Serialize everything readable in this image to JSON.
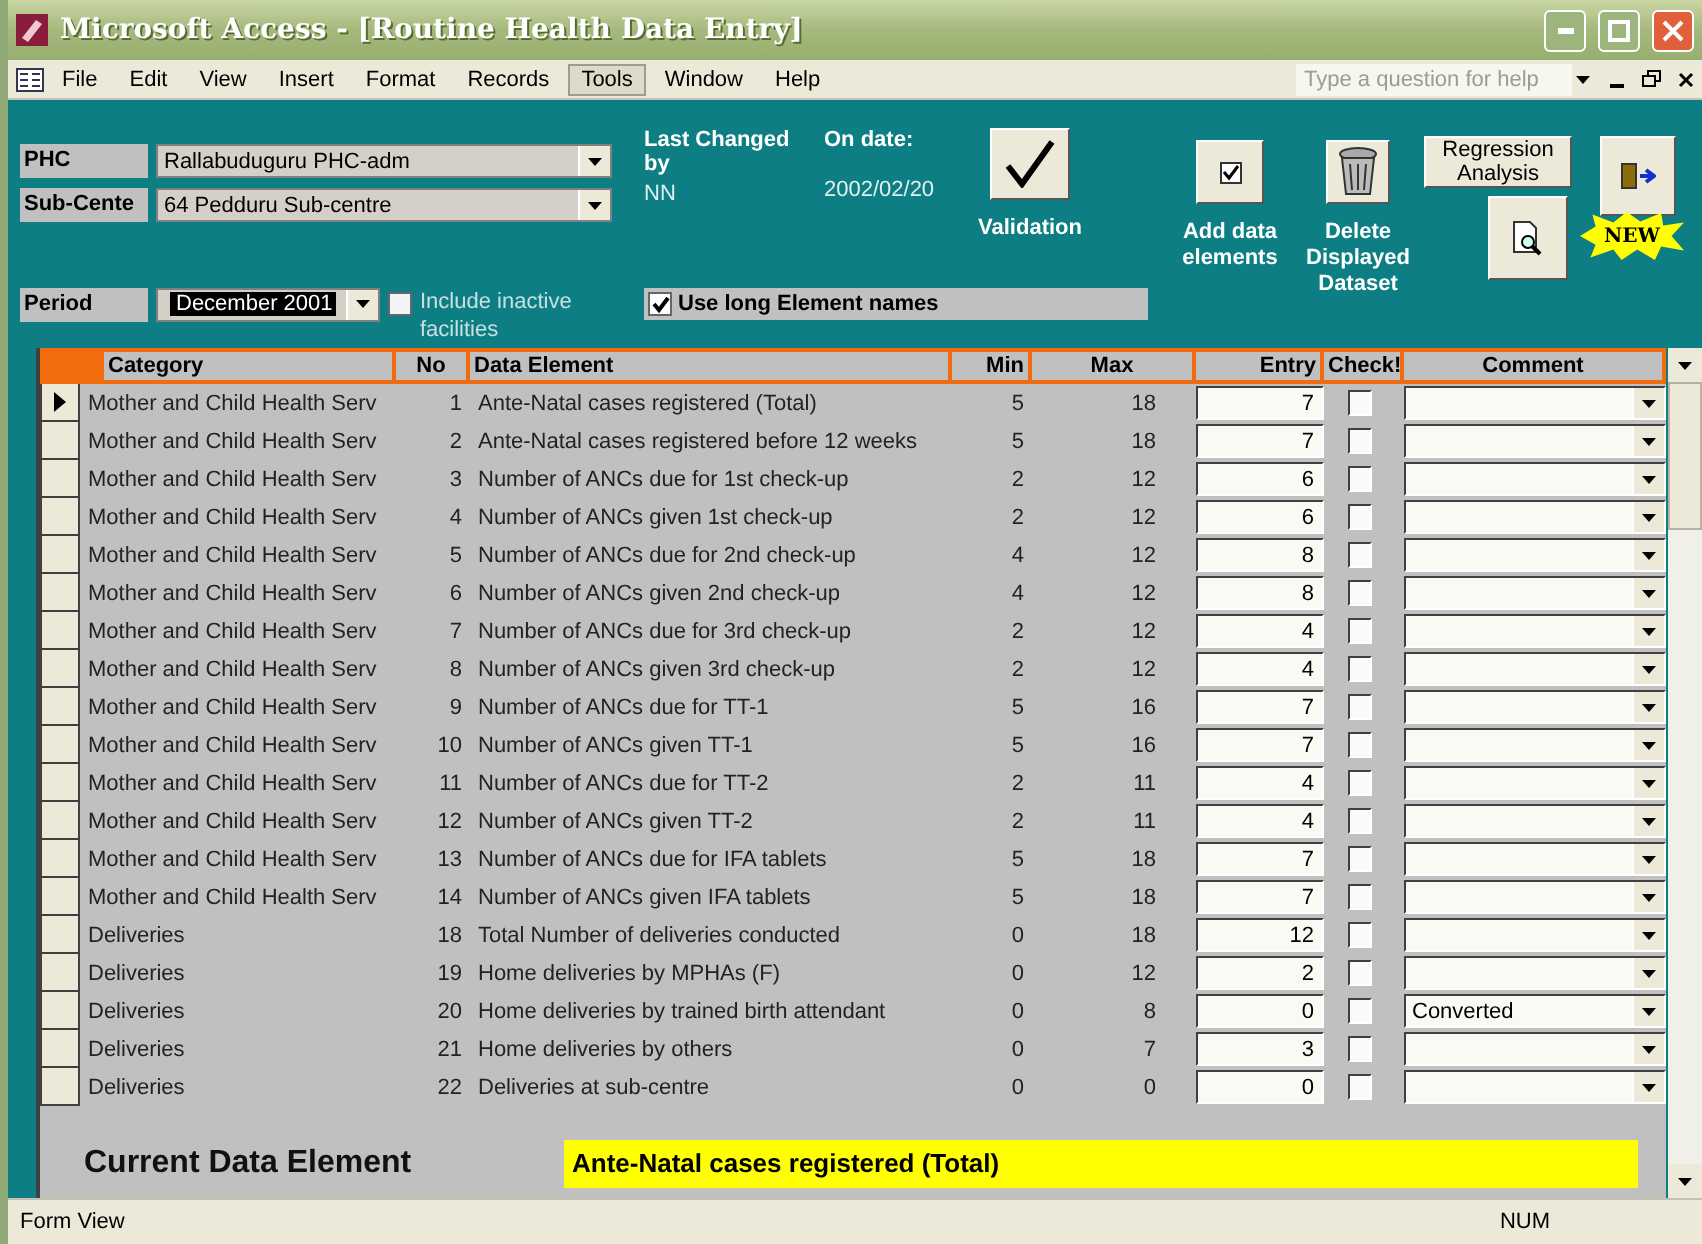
{
  "window": {
    "title": "Microsoft Access - [Routine Health Data Entry]"
  },
  "menu": [
    {
      "label": "File",
      "selected": false
    },
    {
      "label": "Edit",
      "selected": false
    },
    {
      "label": "View",
      "selected": false
    },
    {
      "label": "Insert",
      "selected": false
    },
    {
      "label": "Format",
      "selected": false
    },
    {
      "label": "Records",
      "selected": false
    },
    {
      "label": "Tools",
      "selected": true
    },
    {
      "label": "Window",
      "selected": false
    },
    {
      "label": "Help",
      "selected": false
    }
  ],
  "help_box": {
    "placeholder": "Type a question for help"
  },
  "filters": [
    {
      "label": "PHC",
      "value": "Rallabuduguru PHC-adm"
    },
    {
      "label": "Sub-Cente",
      "value": "64 Pedduru Sub-centre"
    }
  ],
  "period": {
    "label": "Period",
    "value": "December 2001",
    "include_inactive": {
      "label": "Include inactive facilities",
      "checked": false
    }
  },
  "last_changed": {
    "label": "Last Changed by",
    "value": "NN"
  },
  "on_date": {
    "label": "On date:",
    "value": "2002/02/20"
  },
  "use_long_names": {
    "label": "Use long Element names",
    "checked": true
  },
  "actions": {
    "validation": "Validation",
    "add_data": "Add data elements",
    "delete": "Delete Displayed Dataset",
    "regression": "Regression Analysis",
    "new_badge": "NEW"
  },
  "table": {
    "columns": [
      "Category",
      "No",
      "Data Element",
      "Min",
      "Max",
      "Entry",
      "Check!",
      "Comment"
    ],
    "rows": [
      {
        "current": true,
        "category": "Mother and Child Health Serv",
        "no": "1",
        "element": "Ante-Natal cases registered (Total)",
        "min": "5",
        "max": "18",
        "entry": "7",
        "checked": false,
        "comment": ""
      },
      {
        "current": false,
        "category": "Mother and Child Health Serv",
        "no": "2",
        "element": "Ante-Natal cases registered before 12 weeks",
        "min": "5",
        "max": "18",
        "entry": "7",
        "checked": false,
        "comment": ""
      },
      {
        "current": false,
        "category": "Mother and Child Health Serv",
        "no": "3",
        "element": "Number of ANCs due for 1st check-up",
        "min": "2",
        "max": "12",
        "entry": "6",
        "checked": false,
        "comment": ""
      },
      {
        "current": false,
        "category": "Mother and Child Health Serv",
        "no": "4",
        "element": "Number of ANCs given 1st check-up",
        "min": "2",
        "max": "12",
        "entry": "6",
        "checked": false,
        "comment": ""
      },
      {
        "current": false,
        "category": "Mother and Child Health Serv",
        "no": "5",
        "element": "Number of ANCs due for 2nd check-up",
        "min": "4",
        "max": "12",
        "entry": "8",
        "checked": false,
        "comment": ""
      },
      {
        "current": false,
        "category": "Mother and Child Health Serv",
        "no": "6",
        "element": "Number of ANCs given 2nd check-up",
        "min": "4",
        "max": "12",
        "entry": "8",
        "checked": false,
        "comment": ""
      },
      {
        "current": false,
        "category": "Mother and Child Health Serv",
        "no": "7",
        "element": "Number of ANCs due for 3rd check-up",
        "min": "2",
        "max": "12",
        "entry": "4",
        "checked": false,
        "comment": ""
      },
      {
        "current": false,
        "category": "Mother and Child Health Serv",
        "no": "8",
        "element": "Number of ANCs given 3rd check-up",
        "min": "2",
        "max": "12",
        "entry": "4",
        "checked": false,
        "comment": ""
      },
      {
        "current": false,
        "category": "Mother and Child Health Serv",
        "no": "9",
        "element": "Number of ANCs due for TT-1",
        "min": "5",
        "max": "16",
        "entry": "7",
        "checked": false,
        "comment": ""
      },
      {
        "current": false,
        "category": "Mother and Child Health Serv",
        "no": "10",
        "element": "Number of ANCs given TT-1",
        "min": "5",
        "max": "16",
        "entry": "7",
        "checked": false,
        "comment": ""
      },
      {
        "current": false,
        "category": "Mother and Child Health Serv",
        "no": "11",
        "element": "Number of ANCs due for TT-2",
        "min": "2",
        "max": "11",
        "entry": "4",
        "checked": false,
        "comment": ""
      },
      {
        "current": false,
        "category": "Mother and Child Health Serv",
        "no": "12",
        "element": "Number of ANCs given TT-2",
        "min": "2",
        "max": "11",
        "entry": "4",
        "checked": false,
        "comment": ""
      },
      {
        "current": false,
        "category": "Mother and Child Health Serv",
        "no": "13",
        "element": "Number of ANCs due for IFA tablets",
        "min": "5",
        "max": "18",
        "entry": "7",
        "checked": false,
        "comment": ""
      },
      {
        "current": false,
        "category": "Mother and Child Health Serv",
        "no": "14",
        "element": "Number of ANCs given IFA tablets",
        "min": "5",
        "max": "18",
        "entry": "7",
        "checked": false,
        "comment": ""
      },
      {
        "current": false,
        "category": "Deliveries",
        "no": "18",
        "element": "Total Number of deliveries conducted",
        "min": "0",
        "max": "18",
        "entry": "12",
        "checked": false,
        "comment": ""
      },
      {
        "current": false,
        "category": "Deliveries",
        "no": "19",
        "element": "Home deliveries by MPHAs (F)",
        "min": "0",
        "max": "12",
        "entry": "2",
        "checked": false,
        "comment": ""
      },
      {
        "current": false,
        "category": "Deliveries",
        "no": "20",
        "element": "Home deliveries by trained birth attendant",
        "min": "0",
        "max": "8",
        "entry": "0",
        "checked": false,
        "comment": "Converted"
      },
      {
        "current": false,
        "category": "Deliveries",
        "no": "21",
        "element": "Home deliveries by others",
        "min": "0",
        "max": "7",
        "entry": "3",
        "checked": false,
        "comment": ""
      },
      {
        "current": false,
        "category": "Deliveries",
        "no": "22",
        "element": "Deliveries at sub-centre",
        "min": "0",
        "max": "0",
        "entry": "0",
        "checked": false,
        "comment": ""
      }
    ]
  },
  "current_element": {
    "label": "Current Data Element",
    "value": "Ante-Natal cases registered (Total)"
  },
  "status_bar": {
    "mode": "Form View",
    "indicator": "NUM"
  }
}
